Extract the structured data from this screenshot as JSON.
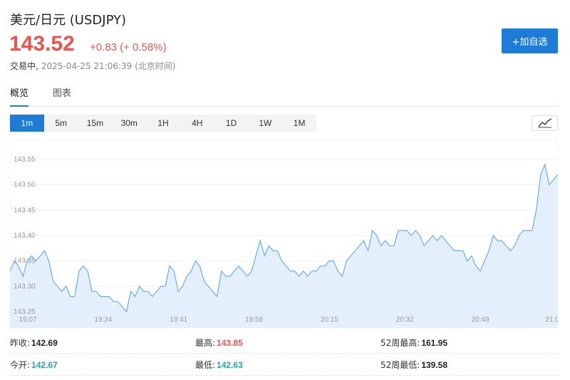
{
  "header": {
    "title": "美元/日元 (USDJPY)",
    "price": "143.52",
    "change": "+0.83 (+ 0.58%)",
    "status": "交易中,",
    "timestamp": "2025-04-25 21:06:39 (北京时间)",
    "add_label": "+加自选"
  },
  "tabs": [
    {
      "label": "概览",
      "active": true
    },
    {
      "label": "图表",
      "active": false
    }
  ],
  "intervals": [
    {
      "label": "1m",
      "active": true
    },
    {
      "label": "5m",
      "active": false
    },
    {
      "label": "15m",
      "active": false
    },
    {
      "label": "30m",
      "active": false
    },
    {
      "label": "1H",
      "active": false
    },
    {
      "label": "4H",
      "active": false
    },
    {
      "label": "1D",
      "active": false
    },
    {
      "label": "1W",
      "active": false
    },
    {
      "label": "1M",
      "active": false
    }
  ],
  "icons": {
    "chart_type": "line-chart-icon"
  },
  "colors": {
    "accent": "#1e7bd6",
    "up": "#ef5350",
    "down": "#26a69a",
    "line": "#6aaee8",
    "fill": "#e3f0fc"
  },
  "chart_data": {
    "type": "area",
    "ylim": [
      143.25,
      143.55
    ],
    "yticks": [
      "143.55",
      "143.50",
      "143.45",
      "143.40",
      "143.35",
      "143.30",
      "143.25"
    ],
    "xticks": [
      "19:07",
      "19:24",
      "19:41",
      "19:58",
      "20:15",
      "20:32",
      "20:49",
      "21:0"
    ],
    "grid": true,
    "values": [
      143.33,
      143.35,
      143.34,
      143.32,
      143.35,
      143.36,
      143.35,
      143.36,
      143.37,
      143.35,
      143.31,
      143.3,
      143.29,
      143.3,
      143.28,
      143.28,
      143.33,
      143.34,
      143.33,
      143.29,
      143.29,
      143.28,
      143.28,
      143.28,
      143.27,
      143.27,
      143.26,
      143.25,
      143.29,
      143.28,
      143.3,
      143.29,
      143.29,
      143.28,
      143.29,
      143.3,
      143.3,
      143.34,
      143.33,
      143.29,
      143.3,
      143.32,
      143.33,
      143.35,
      143.34,
      143.31,
      143.3,
      143.29,
      143.28,
      143.33,
      143.32,
      143.32,
      143.33,
      143.34,
      143.33,
      143.32,
      143.33,
      143.36,
      143.39,
      143.36,
      143.38,
      143.37,
      143.37,
      143.35,
      143.34,
      143.33,
      143.33,
      143.32,
      143.33,
      143.32,
      143.33,
      143.33,
      143.34,
      143.34,
      143.35,
      143.35,
      143.33,
      143.32,
      143.35,
      143.36,
      143.37,
      143.38,
      143.39,
      143.37,
      143.41,
      143.4,
      143.38,
      143.39,
      143.38,
      143.38,
      143.41,
      143.41,
      143.41,
      143.4,
      143.41,
      143.4,
      143.38,
      143.39,
      143.4,
      143.39,
      143.4,
      143.39,
      143.38,
      143.37,
      143.37,
      143.37,
      143.35,
      143.36,
      143.34,
      143.33,
      143.35,
      143.37,
      143.4,
      143.39,
      143.39,
      143.38,
      143.37,
      143.38,
      143.4,
      143.41,
      143.41,
      143.41,
      143.45,
      143.52,
      143.54,
      143.5,
      143.51,
      143.52
    ]
  },
  "stats": [
    [
      {
        "label": "昨收:",
        "value": "142.69",
        "tone": "dark"
      },
      {
        "label": "最高:",
        "value": "143.85",
        "tone": "red"
      },
      {
        "label": "52周最高:",
        "value": "161.95",
        "tone": "dark"
      }
    ],
    [
      {
        "label": "今开:",
        "value": "142.67",
        "tone": "green"
      },
      {
        "label": "最低:",
        "value": "142.63",
        "tone": "green"
      },
      {
        "label": "52周最低:",
        "value": "139.58",
        "tone": "dark"
      }
    ]
  ]
}
